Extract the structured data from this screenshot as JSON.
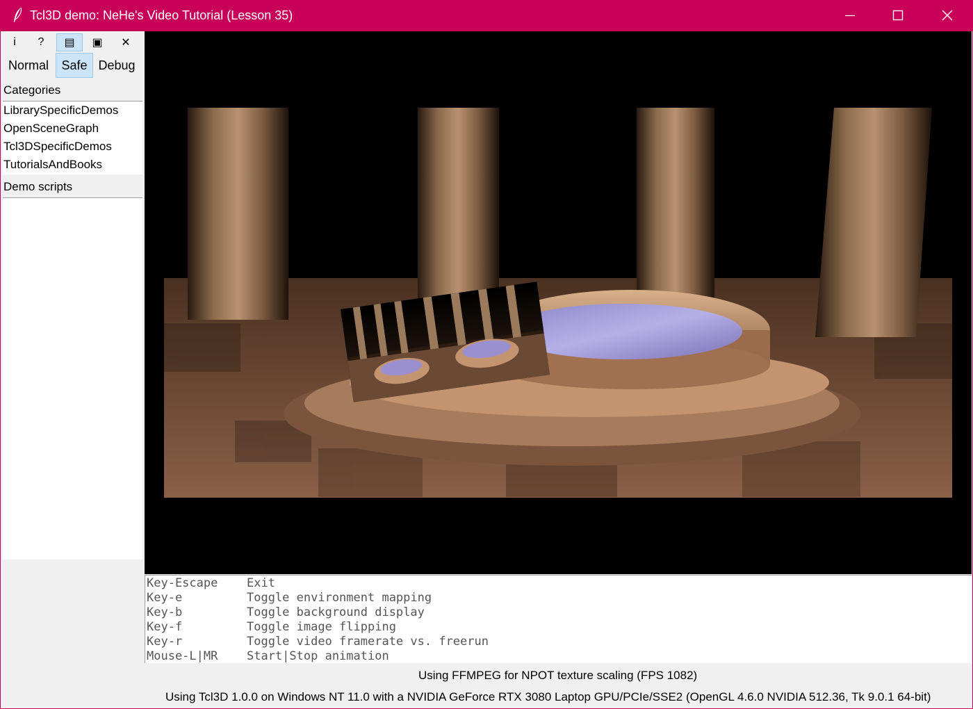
{
  "window": {
    "title": "Tcl3D demo: NeHe's Video Tutorial (Lesson 35)",
    "icon": "feather-icon",
    "controls": [
      "minimize-icon",
      "maximize-icon",
      "close-icon"
    ]
  },
  "toolbar": {
    "icons": [
      {
        "name": "info-icon",
        "glyph": "i"
      },
      {
        "name": "help-icon",
        "glyph": "?"
      },
      {
        "name": "source-icon",
        "glyph": "▤"
      },
      {
        "name": "window-icon",
        "glyph": "▣"
      },
      {
        "name": "exit-icon",
        "glyph": "✕"
      }
    ],
    "modes": [
      "Normal",
      "Safe",
      "Debug"
    ],
    "active_mode": "Safe"
  },
  "categories": {
    "label": "Categories",
    "items": [
      "LibrarySpecificDemos",
      "OpenSceneGraph",
      "Tcl3DSpecificDemos",
      "TutorialsAndBooks"
    ]
  },
  "demo_scripts": {
    "label": "Demo scripts",
    "items": []
  },
  "help": [
    {
      "key": "Key-Escape",
      "action": "Exit"
    },
    {
      "key": "Key-e",
      "action": "Toggle environment mapping"
    },
    {
      "key": "Key-b",
      "action": "Toggle background display"
    },
    {
      "key": "Key-f",
      "action": "Toggle image flipping"
    },
    {
      "key": "Key-r",
      "action": "Toggle video framerate vs. freerun"
    },
    {
      "key": "Mouse-L|MR",
      "action": "Start|Stop animation"
    }
  ],
  "status": {
    "line1": "Using FFMPEG for NPOT texture scaling (FPS 1082)",
    "line2": "Using Tcl3D 1.0.0 on Windows NT 11.0 with a NVIDIA GeForce RTX 3080 Laptop GPU/PCIe/SSE2 (OpenGL 4.6.0 NVIDIA 512.36, Tk 9.0.1 64-bit)"
  },
  "colors": {
    "titlebar": "#c8005a",
    "selected": "#cce4f7"
  }
}
